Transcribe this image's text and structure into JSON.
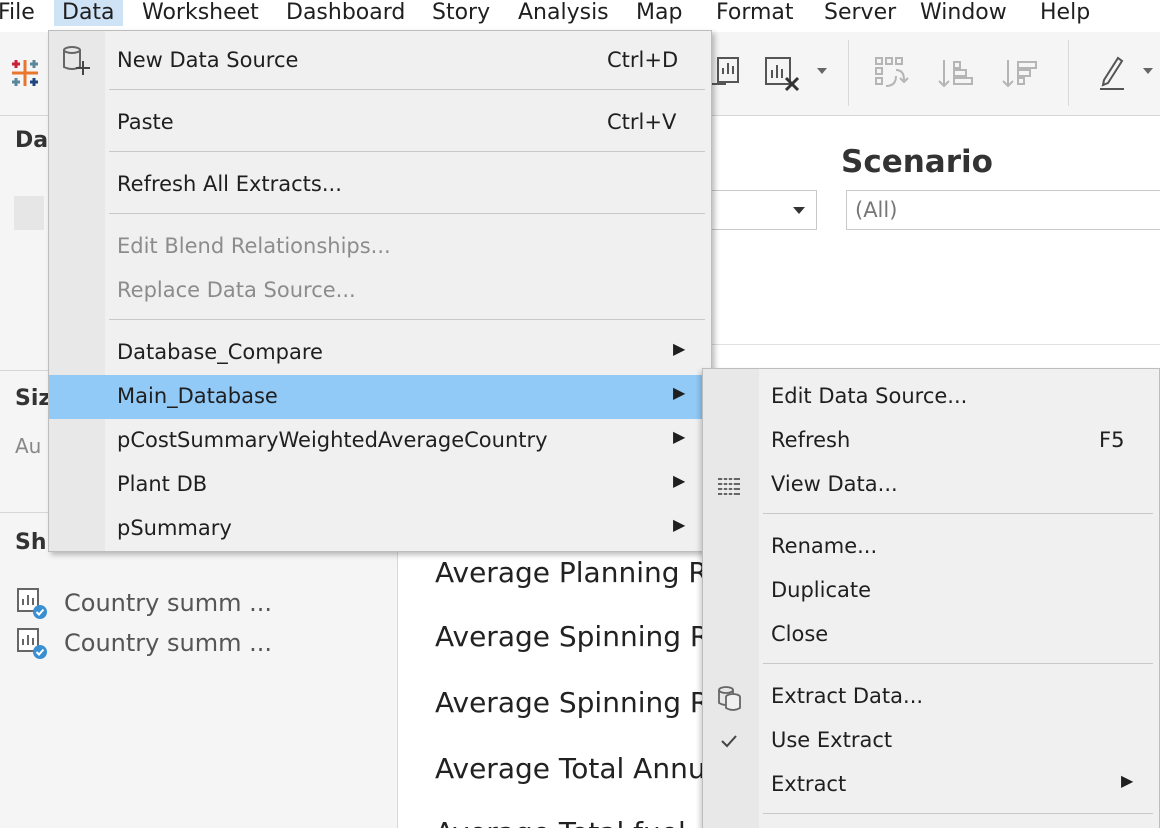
{
  "menubar": [
    "File",
    "Data",
    "Worksheet",
    "Dashboard",
    "Story",
    "Analysis",
    "Map",
    "Format",
    "Server",
    "Window",
    "Help"
  ],
  "left_pane": {
    "data_head": "Da",
    "size_head": "Siz",
    "size_value": "Au",
    "sheets_head": "Sh",
    "sheets": [
      "Country summ ...",
      "Country summ ..."
    ]
  },
  "canvas": {
    "scenario_title": "Scenario",
    "scenario_value": "(All)",
    "metrics": [
      "Average Planning R",
      "Average Spinning R",
      "Average Spinning R",
      "Average Total Annu",
      "Average Total fuel"
    ]
  },
  "data_menu": {
    "items": [
      {
        "label": "New Data Source",
        "shortcut": "Ctrl+D",
        "icon": "new-data-source-icon"
      },
      {
        "label": "Paste",
        "shortcut": "Ctrl+V"
      },
      {
        "label": "Refresh All Extracts..."
      },
      {
        "label": "Edit Blend Relationships...",
        "disabled": true
      },
      {
        "label": "Replace Data Source...",
        "disabled": true
      },
      {
        "label": "Database_Compare",
        "submenu": true
      },
      {
        "label": "Main_Database",
        "submenu": true,
        "highlighted": true
      },
      {
        "label": "pCostSummaryWeightedAverageCountry",
        "submenu": true
      },
      {
        "label": "Plant DB",
        "submenu": true
      },
      {
        "label": "pSummary",
        "submenu": true
      }
    ]
  },
  "submenu": {
    "items": [
      {
        "label": "Edit Data Source..."
      },
      {
        "label": "Refresh",
        "shortcut": "F5"
      },
      {
        "label": "View Data...",
        "icon": "view-data-icon"
      },
      {
        "label": "Rename..."
      },
      {
        "label": "Duplicate"
      },
      {
        "label": "Close"
      },
      {
        "label": "Extract Data...",
        "icon": "extract-data-icon"
      },
      {
        "label": "Use Extract",
        "icon": "checkmark-icon",
        "checked": true
      },
      {
        "label": "Extract",
        "submenu": true
      }
    ]
  },
  "colors": {
    "highlight": "#91c9f7",
    "menu_bg": "#f0f0f0",
    "pane_bg": "#f5f5f5",
    "badge": "#3a8fd0"
  }
}
